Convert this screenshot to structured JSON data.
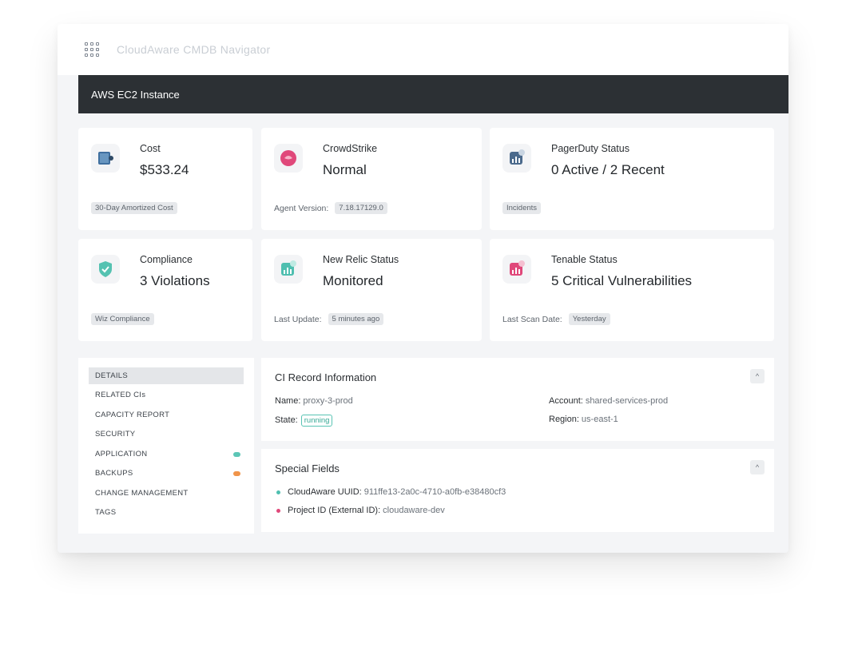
{
  "app": {
    "title": "CloudAware CMDB Navigator"
  },
  "header": {
    "title": "AWS EC2 Instance"
  },
  "cards": [
    {
      "label": "Cost",
      "value": "$533.24",
      "foot_label": "",
      "foot_tag": "30-Day Amortized Cost",
      "icon": "cost-icon"
    },
    {
      "label": "CrowdStrike",
      "value": "Normal",
      "foot_label": "Agent Version:",
      "foot_tag": "7.18.17129.0",
      "icon": "crowdstrike-icon"
    },
    {
      "label": "PagerDuty Status",
      "value": "0 Active / 2  Recent",
      "foot_label": "",
      "foot_tag": "Incidents",
      "icon": "pagerduty-icon"
    },
    {
      "label": "Compliance",
      "value": "3 Violations",
      "foot_label": "",
      "foot_tag": "Wiz Compliance",
      "icon": "shield-icon"
    },
    {
      "label": "New Relic Status",
      "value": "Monitored",
      "foot_label": "Last Update:",
      "foot_tag": "5 minutes ago",
      "icon": "newrelic-icon"
    },
    {
      "label": "Tenable Status",
      "value": "5 Critical Vulnerabilities",
      "foot_label": "Last Scan Date:",
      "foot_tag": "Yesterday",
      "icon": "tenable-icon"
    }
  ],
  "sidebar": {
    "items": [
      {
        "label": "DETAILS",
        "active": true
      },
      {
        "label": "RELATED CIs"
      },
      {
        "label": "CAPACITY REPORT"
      },
      {
        "label": "SECURITY"
      },
      {
        "label": "APPLICATION",
        "dot_color": "#5cc6b6"
      },
      {
        "label": "BACKUPS",
        "dot_color": "#f0944a"
      },
      {
        "label": "CHANGE MANAGEMENT"
      },
      {
        "label": "TAGS"
      }
    ]
  },
  "ci_record": {
    "title": "CI Record Information",
    "name_label": "Name:",
    "name_value": "proxy-3-prod",
    "state_label": "State:",
    "state_value": "running",
    "account_label": "Account:",
    "account_value": "shared-services-prod",
    "region_label": "Region:",
    "region_value": "us-east-1"
  },
  "special_fields": {
    "title": "Special Fields",
    "items": [
      {
        "label": "CloudAware UUID:",
        "value": "911ffe13-2a0c-4710-a0fb-e38480cf3",
        "color": "#4fbfb0"
      },
      {
        "label": "Project ID (External ID):",
        "value": "cloudaware-dev",
        "color": "#e0487a"
      }
    ]
  },
  "colors": {
    "header_bg": "#2c3034",
    "accent_teal": "#4fbfb0",
    "accent_pink": "#e0487a"
  }
}
